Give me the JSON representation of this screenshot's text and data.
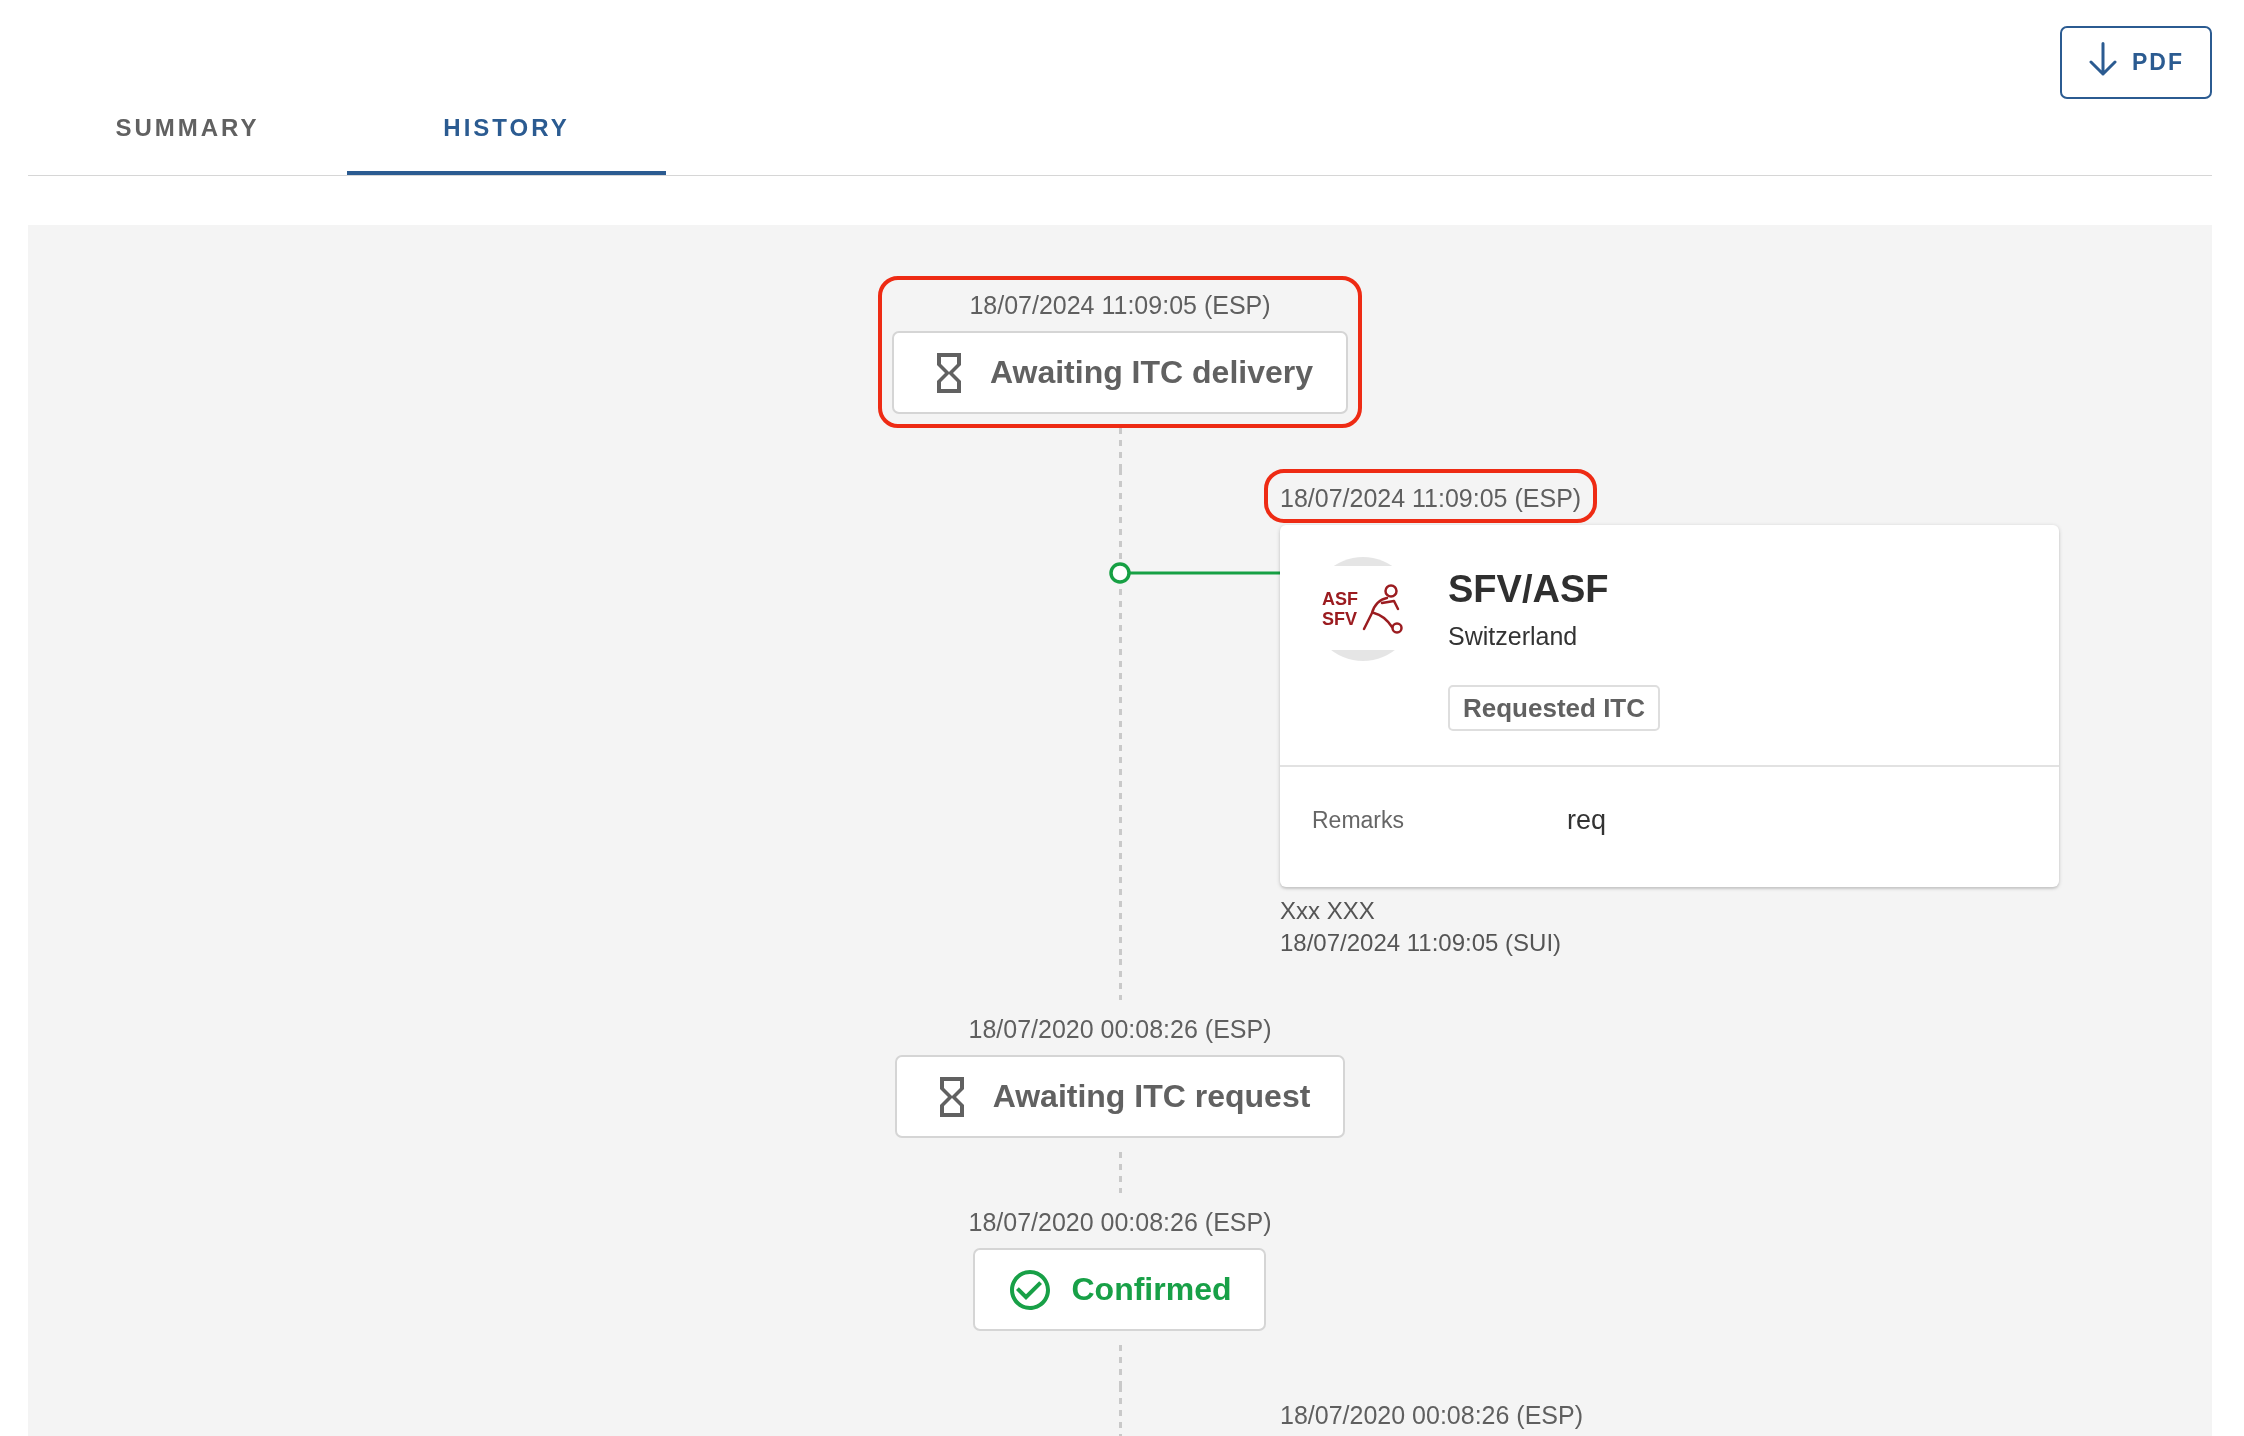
{
  "tabs": [
    {
      "label": "SUMMARY",
      "selected": false
    },
    {
      "label": "HISTORY",
      "selected": true
    }
  ],
  "pdf_button": {
    "label": "PDF"
  },
  "timeline": [
    {
      "kind": "status",
      "timestamp": "18/07/2024 11:09:05 (ESP)",
      "confirmed": false,
      "label": "Awaiting ITC delivery",
      "highlighted": true
    },
    {
      "kind": "action",
      "timestamp": "18/07/2024 11:09:05 (ESP)",
      "highlighted": true,
      "card": {
        "logo_text": [
          "ASF",
          "SFV"
        ],
        "title": "SFV/ASF",
        "subtitle": "Switzerland",
        "tag": "Requested ITC",
        "remarks_label": "Remarks",
        "remarks": "req"
      },
      "author": "Xxx XXX",
      "author_time": "18/07/2024 11:09:05 (SUI)"
    },
    {
      "kind": "status",
      "timestamp": "18/07/2020 00:08:26 (ESP)",
      "confirmed": false,
      "label": "Awaiting ITC request",
      "highlighted": false
    },
    {
      "kind": "status",
      "timestamp": "18/07/2020 00:08:26 (ESP)",
      "confirmed": true,
      "label": "Confirmed",
      "highlighted": false
    },
    {
      "kind": "action",
      "timestamp": "18/07/2020 00:08:26 (ESP)",
      "highlighted": false
    }
  ]
}
